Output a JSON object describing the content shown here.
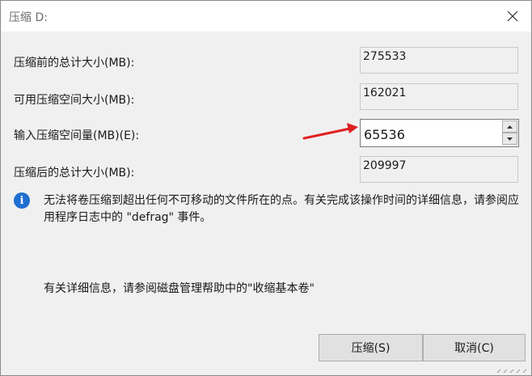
{
  "window": {
    "title": "压缩 D:",
    "close_icon": "close-icon"
  },
  "fields": {
    "total_before": {
      "label": "压缩前的总计大小(MB):",
      "value": "275533"
    },
    "available": {
      "label": "可用压缩空间大小(MB):",
      "value": "162021"
    },
    "shrink_amount": {
      "label": "输入压缩空间量(MB)(E):",
      "value": "65536"
    },
    "total_after": {
      "label": "压缩后的总计大小(MB):",
      "value": "209997"
    }
  },
  "info": {
    "icon": "info-icon",
    "icon_glyph": "i",
    "text": "无法将卷压缩到超出任何不可移动的文件所在的点。有关完成该操作时间的详细信息，请参阅应用程序日志中的 \"defrag\" 事件。"
  },
  "help_text": "有关详细信息，请参阅磁盘管理帮助中的\"收缩基本卷\"",
  "buttons": {
    "shrink": "压缩(S)",
    "cancel": "取消(C)"
  },
  "colors": {
    "dialog_bg": "#f0f0f0",
    "info_blue": "#1f6fd1",
    "annotation_arrow": "#e02020"
  }
}
